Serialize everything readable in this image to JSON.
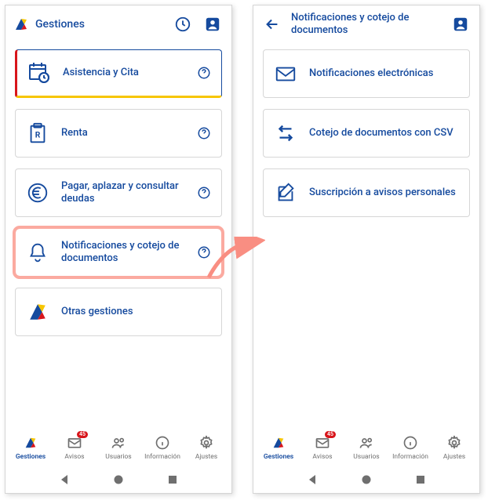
{
  "left": {
    "header_title": "Gestiones",
    "cards": [
      {
        "label": "Asistencia y Cita"
      },
      {
        "label": "Renta"
      },
      {
        "label": "Pagar, aplazar y consultar deudas"
      },
      {
        "label": "Notificaciones y cotejo de documentos"
      },
      {
        "label": "Otras gestiones"
      }
    ]
  },
  "right": {
    "header_title": "Notificaciones y cotejo de documentos",
    "cards": [
      {
        "label": "Notificaciones electrónicas"
      },
      {
        "label": "Cotejo de documentos con CSV"
      },
      {
        "label": "Suscripción a avisos personales"
      }
    ]
  },
  "nav": {
    "items": [
      {
        "label": "Gestiones"
      },
      {
        "label": "Avisos",
        "badge": "45"
      },
      {
        "label": "Usuarios"
      },
      {
        "label": "Información"
      },
      {
        "label": "Ajustes"
      }
    ]
  },
  "colors": {
    "primary": "#154a9e",
    "red": "#d8151b",
    "yellow": "#f7c600",
    "highlight": "#fbaaa0"
  }
}
